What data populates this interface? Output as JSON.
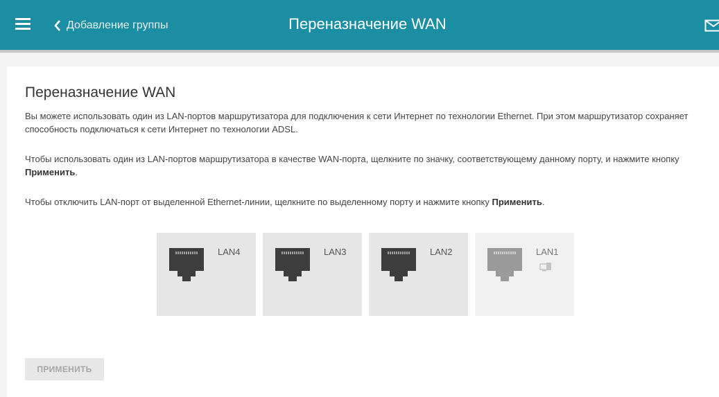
{
  "header": {
    "back_label": "Добавление группы",
    "title": "Переназначение WAN"
  },
  "main": {
    "heading": "Переназначение WAN",
    "para1": "Вы можете использовать один из LAN-портов маршрутизатора для подключения к сети Интернет по технологии Ethernet. При этом маршрутизатор сохраняет способность подключаться к сети Интернет по технологии ADSL.",
    "para2_text": "Чтобы использовать один из LAN-портов маршрутизатора в качестве WAN-порта, щелкните по значку, соответствующему данному порту, и нажмите кнопку ",
    "para2_bold": "Применить",
    "para2_end": ".",
    "para3_text": "Чтобы отключить LAN-порт от выделенной Ethernet-линии, щелкните по выделенному порту и нажмите кнопку ",
    "para3_bold": "Применить",
    "para3_end": ".",
    "ports": [
      {
        "label": "LAN4",
        "state": "active"
      },
      {
        "label": "LAN3",
        "state": "active"
      },
      {
        "label": "LAN2",
        "state": "active"
      },
      {
        "label": "LAN1",
        "state": "disabled"
      }
    ],
    "apply_label": "ПРИМЕНИТЬ"
  },
  "colors": {
    "header": "#1c8ea4",
    "port_icon_active": "#3d3d3d",
    "port_icon_disabled": "#9a9a9a"
  }
}
